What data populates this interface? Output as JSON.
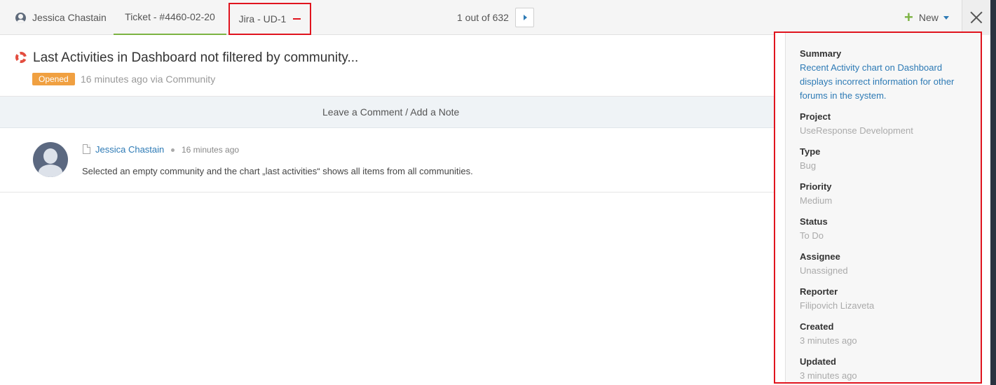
{
  "tabs": {
    "user": "Jessica Chastain",
    "ticket": "Ticket - #4460-02-20",
    "jira": "Jira - UD-1"
  },
  "pager": {
    "text": "1 out of 632"
  },
  "toolbar": {
    "new_label": "New"
  },
  "ticket": {
    "title": "Last Activities in Dashboard not filtered by community...",
    "status": "Opened",
    "meta": "16 minutes ago via Community"
  },
  "comment_bar": {
    "label": "Leave a Comment / Add a Note"
  },
  "activity": {
    "author": "Jessica Chastain",
    "time": "16 minutes ago",
    "message": "Selected an empty community and the chart „last activities“ shows all items from all communities."
  },
  "jira": {
    "fields": [
      {
        "label": "Summary",
        "value": "Recent Activity chart on Dashboard displays incorrect information for other forums in the system."
      },
      {
        "label": "Project",
        "value": "UseResponse Development"
      },
      {
        "label": "Type",
        "value": "Bug"
      },
      {
        "label": "Priority",
        "value": "Medium"
      },
      {
        "label": "Status",
        "value": "To Do"
      },
      {
        "label": "Assignee",
        "value": "Unassigned"
      },
      {
        "label": "Reporter",
        "value": "Filipovich Lizaveta"
      },
      {
        "label": "Created",
        "value": "3 minutes ago"
      },
      {
        "label": "Updated",
        "value": "3 minutes ago"
      }
    ]
  },
  "colors": {
    "highlight": "#e0141e",
    "link": "#2d7ab5",
    "accent_green": "#7cb342",
    "status_opened": "#f0a041"
  }
}
